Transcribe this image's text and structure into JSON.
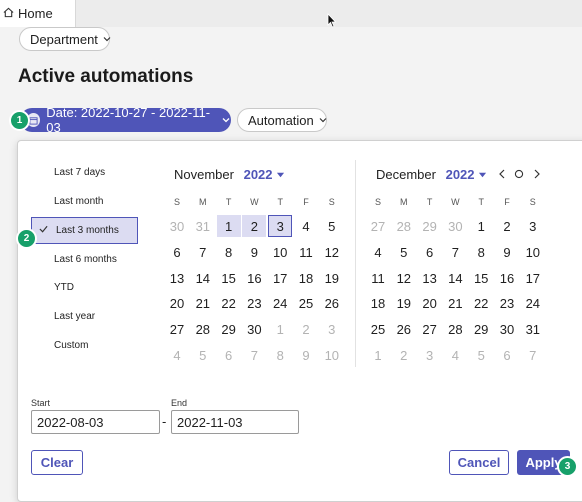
{
  "tab": {
    "label": "Home"
  },
  "filters": {
    "department_label": "Department",
    "automation_label": "Automation"
  },
  "page_title": "Active automations",
  "date_filter_label": "Date: 2022-10-27 - 2022-11-03",
  "badges": {
    "b1": "1",
    "b2": "2",
    "b3": "3"
  },
  "presets": [
    "Last 7 days",
    "Last month",
    "Last 3 months",
    "Last 6 months",
    "YTD",
    "Last year",
    "Custom"
  ],
  "selected_preset_index": 2,
  "weekdays": [
    "S",
    "M",
    "T",
    "W",
    "T",
    "F",
    "S"
  ],
  "calendars": [
    {
      "month": "November",
      "year": "2022",
      "weeks": [
        [
          {
            "d": "30",
            "s": "muted"
          },
          {
            "d": "31",
            "s": "muted"
          },
          {
            "d": "1",
            "s": "range"
          },
          {
            "d": "2",
            "s": "range"
          },
          {
            "d": "3",
            "s": "end"
          },
          {
            "d": "4"
          },
          {
            "d": "5"
          }
        ],
        [
          {
            "d": "6"
          },
          {
            "d": "7"
          },
          {
            "d": "8"
          },
          {
            "d": "9"
          },
          {
            "d": "10"
          },
          {
            "d": "11"
          },
          {
            "d": "12"
          }
        ],
        [
          {
            "d": "13"
          },
          {
            "d": "14"
          },
          {
            "d": "15"
          },
          {
            "d": "16"
          },
          {
            "d": "17"
          },
          {
            "d": "18"
          },
          {
            "d": "19"
          }
        ],
        [
          {
            "d": "20"
          },
          {
            "d": "21"
          },
          {
            "d": "22"
          },
          {
            "d": "23"
          },
          {
            "d": "24"
          },
          {
            "d": "25"
          },
          {
            "d": "26"
          }
        ],
        [
          {
            "d": "27"
          },
          {
            "d": "28"
          },
          {
            "d": "29"
          },
          {
            "d": "30"
          },
          {
            "d": "1",
            "s": "muted"
          },
          {
            "d": "2",
            "s": "muted"
          },
          {
            "d": "3",
            "s": "muted"
          }
        ],
        [
          {
            "d": "4",
            "s": "muted"
          },
          {
            "d": "5",
            "s": "muted"
          },
          {
            "d": "6",
            "s": "muted"
          },
          {
            "d": "7",
            "s": "muted"
          },
          {
            "d": "8",
            "s": "muted"
          },
          {
            "d": "9",
            "s": "muted"
          },
          {
            "d": "10",
            "s": "muted"
          }
        ]
      ]
    },
    {
      "month": "December",
      "year": "2022",
      "weeks": [
        [
          {
            "d": "27",
            "s": "muted"
          },
          {
            "d": "28",
            "s": "muted"
          },
          {
            "d": "29",
            "s": "muted"
          },
          {
            "d": "30",
            "s": "muted"
          },
          {
            "d": "1"
          },
          {
            "d": "2"
          },
          {
            "d": "3"
          }
        ],
        [
          {
            "d": "4"
          },
          {
            "d": "5"
          },
          {
            "d": "6"
          },
          {
            "d": "7"
          },
          {
            "d": "8"
          },
          {
            "d": "9"
          },
          {
            "d": "10"
          }
        ],
        [
          {
            "d": "11"
          },
          {
            "d": "12"
          },
          {
            "d": "13"
          },
          {
            "d": "14"
          },
          {
            "d": "15"
          },
          {
            "d": "16"
          },
          {
            "d": "17"
          }
        ],
        [
          {
            "d": "18"
          },
          {
            "d": "19"
          },
          {
            "d": "20"
          },
          {
            "d": "21"
          },
          {
            "d": "22"
          },
          {
            "d": "23"
          },
          {
            "d": "24"
          }
        ],
        [
          {
            "d": "25"
          },
          {
            "d": "26"
          },
          {
            "d": "27"
          },
          {
            "d": "28"
          },
          {
            "d": "29"
          },
          {
            "d": "30"
          },
          {
            "d": "31"
          }
        ],
        [
          {
            "d": "1",
            "s": "muted"
          },
          {
            "d": "2",
            "s": "muted"
          },
          {
            "d": "3",
            "s": "muted"
          },
          {
            "d": "4",
            "s": "muted"
          },
          {
            "d": "5",
            "s": "muted"
          },
          {
            "d": "6",
            "s": "muted"
          },
          {
            "d": "7",
            "s": "muted"
          }
        ]
      ]
    }
  ],
  "range_fields": {
    "start_label": "Start",
    "start_value": "2022-08-03",
    "separator": "-",
    "end_label": "End",
    "end_value": "2022-11-03"
  },
  "buttons": {
    "clear": "Clear",
    "cancel": "Cancel",
    "apply": "Apply"
  },
  "colors": {
    "accent": "#4f55b8",
    "badge": "#17a06a",
    "range_fill": "#dcdcf2"
  },
  "icons": [
    "home-icon",
    "mouse-cursor-icon",
    "chevron-down-icon",
    "calendar-icon",
    "checkmark-icon",
    "caret-down-icon",
    "chevron-left-icon",
    "today-circle-icon",
    "chevron-right-icon"
  ]
}
